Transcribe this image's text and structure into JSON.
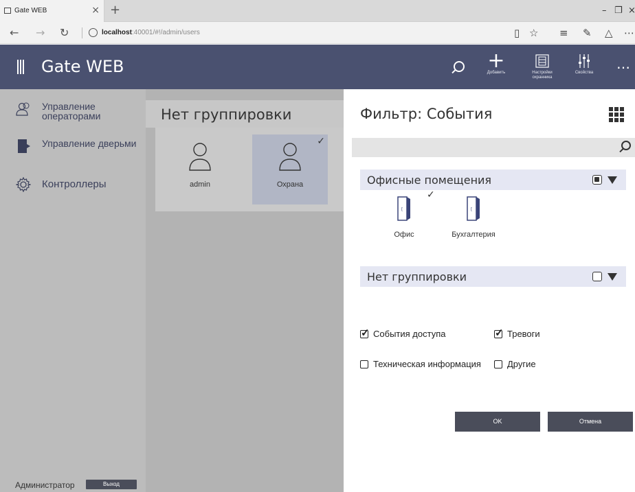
{
  "browser": {
    "tab_title": "Gate WEB",
    "url_host": "localhost",
    "url_rest": ":40001/#!/admin/users"
  },
  "app": {
    "title": "Gate WEB",
    "header_buttons": [
      {
        "label": "Добавить"
      },
      {
        "label": "Настройки охранника"
      },
      {
        "label": "Свойства"
      }
    ]
  },
  "sidebar": {
    "items": [
      {
        "label": "Управление операторами"
      },
      {
        "label": "Управление дверьми"
      },
      {
        "label": "Контроллеры"
      }
    ],
    "user": "Администратор",
    "logout": "Выход"
  },
  "center": {
    "group_title": "Нет группировки",
    "users": [
      {
        "name": "admin",
        "selected": false
      },
      {
        "name": "Охрана",
        "selected": true
      }
    ]
  },
  "filter": {
    "title": "Фильтр: События",
    "search_placeholder": "",
    "groups": [
      {
        "name": "Офисные помещения",
        "state": "partial"
      },
      {
        "name": "Нет группировки",
        "state": "unchecked"
      }
    ],
    "doors": [
      {
        "name": "Офис",
        "checked": true
      },
      {
        "name": "Бухгалтерия",
        "checked": false
      }
    ],
    "event_types": [
      {
        "label": "События доступа",
        "checked": true
      },
      {
        "label": "Тревоги",
        "checked": true
      },
      {
        "label": "Техническая информация",
        "checked": false
      },
      {
        "label": "Другие",
        "checked": false
      }
    ],
    "ok": "OK",
    "cancel": "Отмена"
  },
  "colors": {
    "header": "#4a5170",
    "sidebar": "#bcbcbc",
    "group_bg": "#e5e7f3",
    "button": "#4a4d5a"
  }
}
